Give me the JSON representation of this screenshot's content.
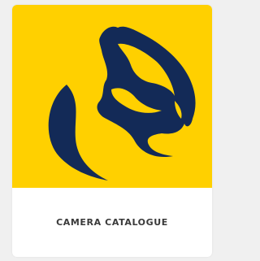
{
  "card": {
    "label": "CAMERA CATALOGUE",
    "logo_icon": "lion-head-logo-icon",
    "colors": {
      "background": "#ffd000",
      "logo": "#132a57",
      "label": "#3a3a3a"
    }
  }
}
